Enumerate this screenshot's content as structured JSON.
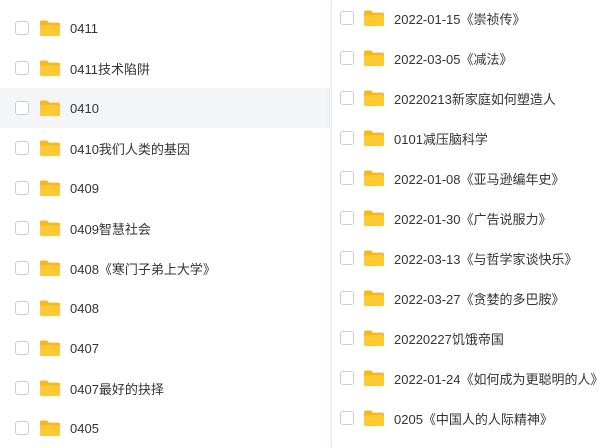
{
  "colors": {
    "folder": "#ffc933",
    "folder_back": "#f5b91f",
    "hover_row": "#f4f5f7",
    "text": "#333333"
  },
  "left_list": {
    "items": [
      {
        "name": "0411",
        "icon": "folder-icon"
      },
      {
        "name": "0411技术陷阱",
        "icon": "folder-icon"
      },
      {
        "name": "0410",
        "icon": "folder-icon",
        "hovered": true
      },
      {
        "name": "0410我们人类的基因",
        "icon": "folder-icon"
      },
      {
        "name": "0409",
        "icon": "folder-icon"
      },
      {
        "name": "0409智慧社会",
        "icon": "folder-icon"
      },
      {
        "name": "0408《寒门子弟上大学》",
        "icon": "folder-icon"
      },
      {
        "name": "0408",
        "icon": "folder-icon"
      },
      {
        "name": "0407",
        "icon": "folder-icon"
      },
      {
        "name": "0407最好的抉择",
        "icon": "folder-icon"
      },
      {
        "name": "0405",
        "icon": "folder-icon"
      }
    ]
  },
  "right_list": {
    "items": [
      {
        "name": "2022-01-15《崇祯传》",
        "icon": "folder-icon"
      },
      {
        "name": "2022-03-05《减法》",
        "icon": "folder-icon"
      },
      {
        "name": "20220213新家庭如何塑造人",
        "icon": "folder-icon"
      },
      {
        "name": "0101减压脑科学",
        "icon": "folder-icon"
      },
      {
        "name": "2022-01-08《亚马逊编年史》",
        "icon": "folder-icon"
      },
      {
        "name": "2022-01-30《广告说服力》",
        "icon": "folder-icon"
      },
      {
        "name": "2022-03-13《与哲学家谈快乐》",
        "icon": "folder-icon"
      },
      {
        "name": "2022-03-27《贪婪的多巴胺》",
        "icon": "folder-icon"
      },
      {
        "name": "20220227饥饿帝国",
        "icon": "folder-icon"
      },
      {
        "name": "2022-01-24《如何成为更聪明的人》",
        "icon": "folder-icon"
      },
      {
        "name": "0205《中国人的人际精神》",
        "icon": "folder-icon"
      }
    ]
  }
}
